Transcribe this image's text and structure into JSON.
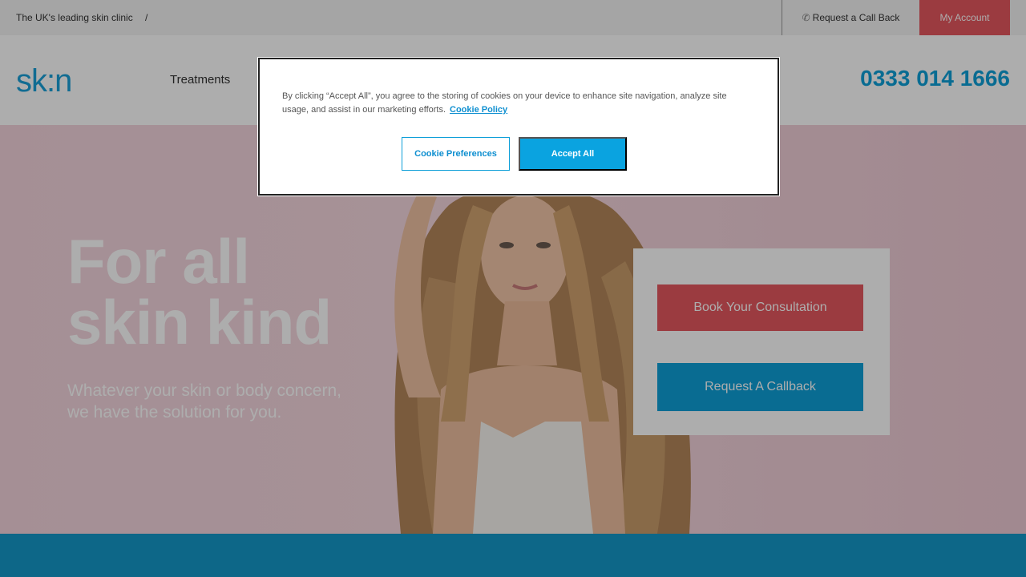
{
  "topbar": {
    "tagline": "The UK's leading skin clinic",
    "separator": "/",
    "callback_label": "Request a Call Back",
    "account_label": "My Account"
  },
  "header": {
    "logo_text": "sk:n",
    "nav_treatments": "Treatments",
    "phone": "0333 014 1666"
  },
  "hero": {
    "title_line1": "For all",
    "title_line2": "skin kind",
    "subtitle_line1": "Whatever your skin or body concern,",
    "subtitle_line2": "we have the solution for you.",
    "book_label": "Book Your Consultation",
    "callback_label": "Request A Callback"
  },
  "cookie": {
    "text": "By clicking “Accept All”, you agree to the storing of cookies on your device to enhance site navigation, analyze site usage, and assist in our marketing efforts.",
    "policy_link": "Cookie Policy",
    "preferences_label": "Cookie Preferences",
    "accept_label": "Accept All"
  },
  "colors": {
    "brand_blue": "#0e9fd8",
    "brand_coral": "#e5585f"
  }
}
